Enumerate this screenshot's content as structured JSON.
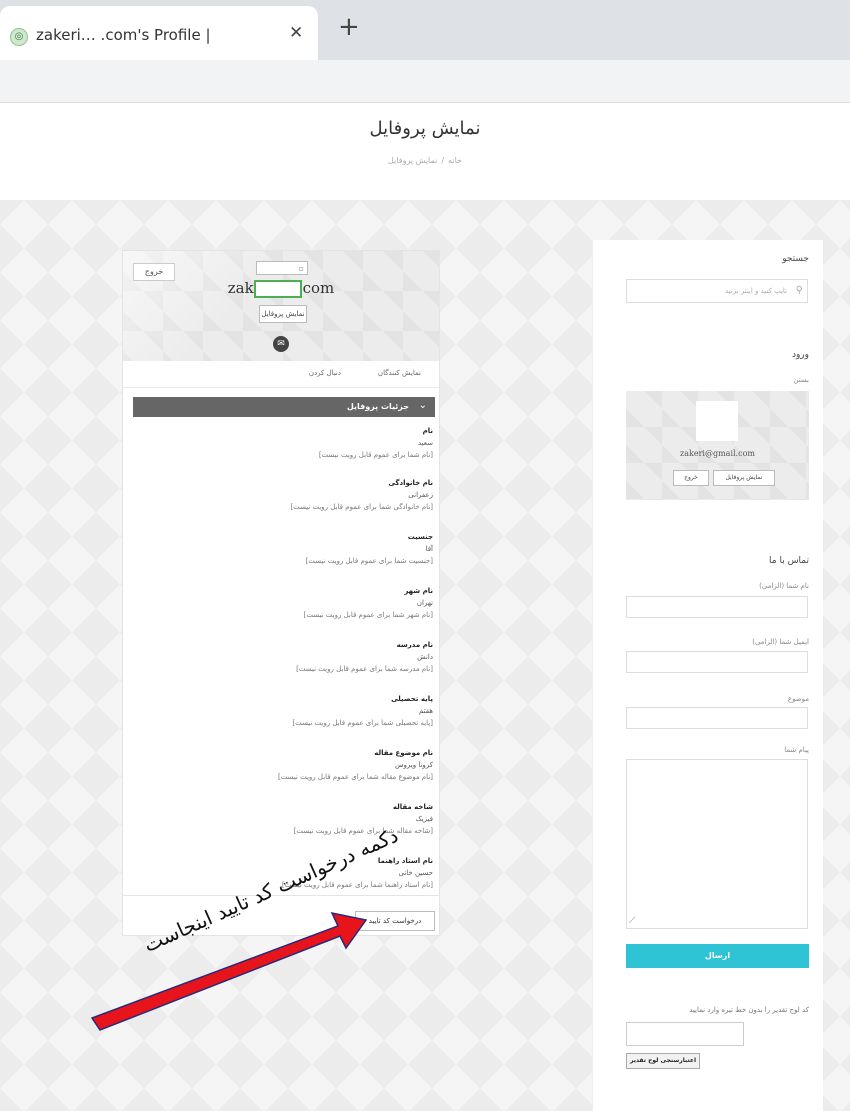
{
  "browser": {
    "tab_title": "zakeri… .com's Profile | ",
    "close_glyph": "✕",
    "new_tab_glyph": "+"
  },
  "page": {
    "title": "نمایش پروفایل",
    "breadcrumb": [
      "خانه",
      "نمایش پروفایل"
    ]
  },
  "profile": {
    "logout_label": "خروج",
    "email": "zakeri          ail.com",
    "show_profile_label": "نمایش پروفایل",
    "tabs": [
      "نمایش کنندگان",
      "دنبال کردن"
    ],
    "details_title": "جزئیات پروفایل",
    "fields": [
      {
        "label": "نام",
        "value": "سعید",
        "note": "[نام شما برای عموم قابل رویت نیست]"
      },
      {
        "label": "نام خانوادگی",
        "value": "زعفرانی",
        "note": "[نام خانوادگی شما برای عموم قابل رویت نیست]"
      },
      {
        "label": "جنسیت",
        "value": "آقا",
        "note": "[جنسیت شما برای عموم قابل رویت نیست]"
      },
      {
        "label": "نام شهر",
        "value": "تهران",
        "note": "[نام شهر شما برای عموم قابل رویت نیست]"
      },
      {
        "label": "نام مدرسه",
        "value": "دانش",
        "note": "[نام مدرسه شما برای عموم قابل رویت نیست]"
      },
      {
        "label": "پایه تحصیلی",
        "value": "هفتم",
        "note": "[پایه تحصیلی شما برای عموم قابل رویت نیست]"
      },
      {
        "label": "نام موضوع مقاله",
        "value": "کرونا ویروس",
        "note": "[نام موضوع مقاله شما برای عموم قابل رویت نیست]"
      },
      {
        "label": "شاخه مقاله",
        "value": "فیزیک",
        "note": "[شاخه مقاله شما برای عموم قابل رویت نیست]"
      },
      {
        "label": "نام استاد راهنما",
        "value": "حسین خانی",
        "note": "[نام استاد راهنما شما برای عموم قابل رویت نیست]"
      }
    ],
    "request_code_label": "درخواست کد تایید"
  },
  "sidebar": {
    "search_heading": "جستجو",
    "search_placeholder": "تایپ کنید و اینتر بزنید",
    "login_heading": "ورود",
    "login_sub": "بستن",
    "login_email": "zakeri@gmail.com",
    "login_show_profile": "نمایش پروفایل",
    "login_exit": "خروج",
    "contact_heading": "تماس با ما",
    "name_label": "نام شما (الزامی)",
    "email_label": "ایمیل شما (الزامی)",
    "subject_label": "موضوع",
    "message_label": "پیام شما",
    "send_label": "ارسال",
    "captcha_label": "کد لوح تقدیر را بدون خط تیره وارد نمایید",
    "captcha_button": "اعتبارسنجی لوح تقدیر"
  },
  "annotation": {
    "text": "دکمه درخواست کد تایید اینجاست",
    "arrow_color": "#e8141b"
  }
}
